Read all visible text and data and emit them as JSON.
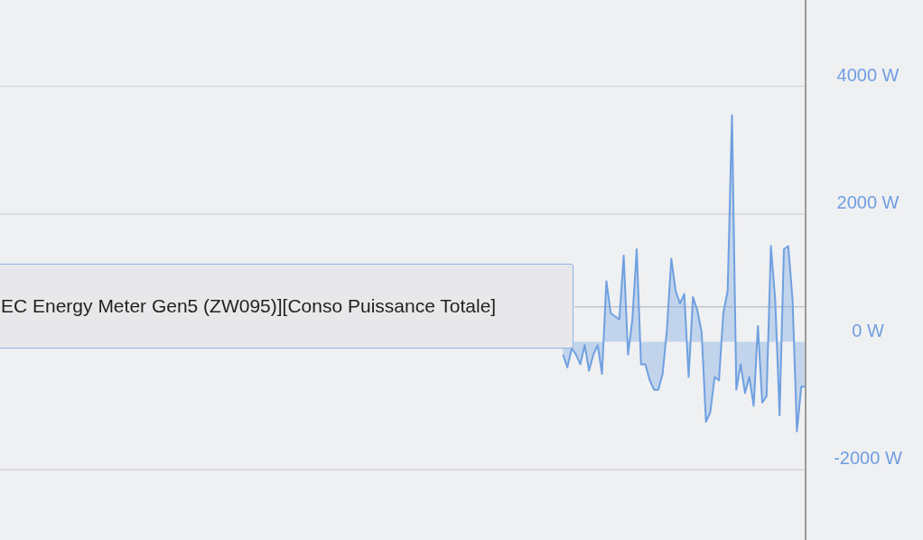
{
  "chart": {
    "chart_data": {
      "type": "area",
      "grid": true,
      "ylim": [
        -3100,
        5350
      ],
      "yticks": [
        {
          "value": 4000,
          "label": "4000 W"
        },
        {
          "value": 2000,
          "label": "2000 W"
        },
        {
          "value": 0,
          "label": "0 W"
        },
        {
          "value": -2000,
          "label": "-2000 W"
        }
      ],
      "ref_lines": [
        {
          "axis": "y",
          "value": 550
        }
      ],
      "categories": [
        null,
        null,
        null,
        null,
        null,
        null,
        null,
        null,
        null,
        null,
        null,
        null,
        null,
        null,
        null,
        null,
        null,
        null,
        null,
        null,
        null,
        null,
        null,
        null,
        null,
        null,
        null,
        null,
        null,
        null,
        null,
        null,
        null,
        null,
        null,
        null,
        null,
        null,
        null,
        null,
        null,
        null,
        null,
        null,
        null,
        null,
        null,
        null,
        null,
        null,
        null,
        null,
        null,
        null,
        null,
        null,
        null,
        null,
        null,
        null,
        null,
        null,
        null,
        null,
        null,
        null,
        null,
        null,
        null,
        null,
        null,
        null,
        null,
        null,
        null,
        null,
        null,
        null,
        null,
        null,
        null,
        null,
        null,
        null,
        null,
        null,
        null,
        null,
        null,
        null,
        null,
        null,
        null,
        null,
        null,
        null,
        null,
        null,
        null,
        null,
        null,
        null,
        null,
        null,
        null,
        null,
        null,
        null,
        null,
        null,
        null,
        null,
        null,
        null,
        null,
        null,
        null,
        null,
        null,
        null,
        null,
        null,
        null,
        null,
        null,
        null,
        null,
        null,
        null,
        null,
        null,
        null,
        null,
        null,
        null,
        null,
        null,
        null,
        null,
        null,
        null,
        null,
        null,
        null,
        null,
        null,
        null,
        null,
        null,
        null,
        null,
        null,
        null,
        null,
        null,
        null,
        null,
        null,
        null,
        null,
        null,
        null,
        null,
        null,
        null,
        null,
        null,
        null,
        null,
        null,
        null,
        null,
        null,
        null,
        null,
        null,
        null,
        null,
        null,
        null,
        null,
        null,
        null,
        null,
        null,
        null,
        null
      ],
      "series": [
        {
          "color": "#6fa0e0",
          "values": [
            null,
            null,
            null,
            null,
            null,
            null,
            null,
            null,
            null,
            null,
            null,
            null,
            null,
            null,
            null,
            null,
            null,
            null,
            null,
            null,
            null,
            null,
            null,
            null,
            null,
            null,
            null,
            null,
            null,
            null,
            null,
            null,
            null,
            null,
            null,
            null,
            null,
            null,
            null,
            null,
            null,
            null,
            null,
            null,
            null,
            null,
            null,
            null,
            null,
            null,
            null,
            null,
            null,
            null,
            null,
            null,
            null,
            null,
            null,
            null,
            null,
            null,
            null,
            null,
            null,
            null,
            null,
            null,
            null,
            null,
            null,
            null,
            null,
            null,
            null,
            null,
            null,
            null,
            null,
            null,
            null,
            null,
            null,
            null,
            null,
            null,
            null,
            null,
            null,
            null,
            null,
            null,
            null,
            null,
            null,
            null,
            null,
            null,
            null,
            null,
            null,
            null,
            null,
            null,
            null,
            null,
            null,
            null,
            null,
            null,
            null,
            null,
            null,
            null,
            null,
            null,
            null,
            null,
            null,
            null,
            null,
            null,
            null,
            null,
            null,
            null,
            null,
            null,
            null,
            null,
            -200,
            -400,
            -100,
            -200,
            -350,
            -50,
            -450,
            -200,
            -50,
            -500,
            950,
            450,
            400,
            350,
            1350,
            -200,
            350,
            1450,
            -350,
            -350,
            -600,
            -750,
            -750,
            -500,
            200,
            1300,
            800,
            600,
            750,
            -550,
            700,
            500,
            150,
            -1250,
            -1100,
            -550,
            -600,
            450,
            800,
            3550,
            -750,
            -350,
            -800,
            -550,
            -1000,
            250,
            -950,
            -850,
            1500,
            650,
            -1150,
            1450,
            1500,
            650,
            -1400,
            -700,
            -700
          ]
        }
      ]
    }
  },
  "tooltip": {
    "text": "EC Energy Meter Gen5 (ZW095)][Conso Puissance Totale]"
  }
}
